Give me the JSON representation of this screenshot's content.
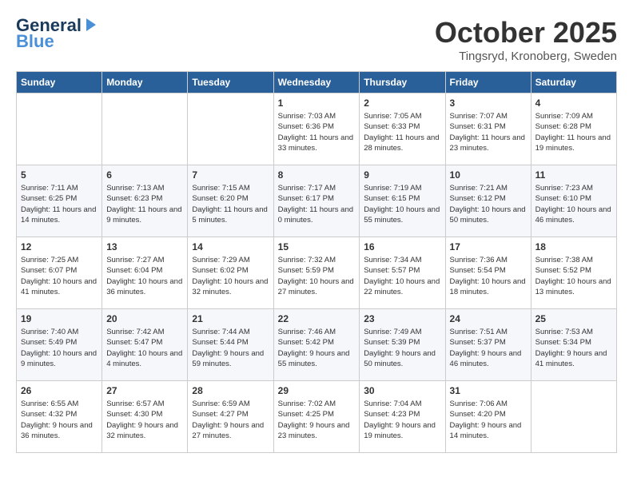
{
  "header": {
    "logo_line1": "General",
    "logo_line2": "Blue",
    "month": "October 2025",
    "location": "Tingsryd, Kronoberg, Sweden"
  },
  "days_of_week": [
    "Sunday",
    "Monday",
    "Tuesday",
    "Wednesday",
    "Thursday",
    "Friday",
    "Saturday"
  ],
  "weeks": [
    [
      {
        "num": "",
        "sunrise": "",
        "sunset": "",
        "daylight": ""
      },
      {
        "num": "",
        "sunrise": "",
        "sunset": "",
        "daylight": ""
      },
      {
        "num": "",
        "sunrise": "",
        "sunset": "",
        "daylight": ""
      },
      {
        "num": "1",
        "sunrise": "Sunrise: 7:03 AM",
        "sunset": "Sunset: 6:36 PM",
        "daylight": "Daylight: 11 hours and 33 minutes."
      },
      {
        "num": "2",
        "sunrise": "Sunrise: 7:05 AM",
        "sunset": "Sunset: 6:33 PM",
        "daylight": "Daylight: 11 hours and 28 minutes."
      },
      {
        "num": "3",
        "sunrise": "Sunrise: 7:07 AM",
        "sunset": "Sunset: 6:31 PM",
        "daylight": "Daylight: 11 hours and 23 minutes."
      },
      {
        "num": "4",
        "sunrise": "Sunrise: 7:09 AM",
        "sunset": "Sunset: 6:28 PM",
        "daylight": "Daylight: 11 hours and 19 minutes."
      }
    ],
    [
      {
        "num": "5",
        "sunrise": "Sunrise: 7:11 AM",
        "sunset": "Sunset: 6:25 PM",
        "daylight": "Daylight: 11 hours and 14 minutes."
      },
      {
        "num": "6",
        "sunrise": "Sunrise: 7:13 AM",
        "sunset": "Sunset: 6:23 PM",
        "daylight": "Daylight: 11 hours and 9 minutes."
      },
      {
        "num": "7",
        "sunrise": "Sunrise: 7:15 AM",
        "sunset": "Sunset: 6:20 PM",
        "daylight": "Daylight: 11 hours and 5 minutes."
      },
      {
        "num": "8",
        "sunrise": "Sunrise: 7:17 AM",
        "sunset": "Sunset: 6:17 PM",
        "daylight": "Daylight: 11 hours and 0 minutes."
      },
      {
        "num": "9",
        "sunrise": "Sunrise: 7:19 AM",
        "sunset": "Sunset: 6:15 PM",
        "daylight": "Daylight: 10 hours and 55 minutes."
      },
      {
        "num": "10",
        "sunrise": "Sunrise: 7:21 AM",
        "sunset": "Sunset: 6:12 PM",
        "daylight": "Daylight: 10 hours and 50 minutes."
      },
      {
        "num": "11",
        "sunrise": "Sunrise: 7:23 AM",
        "sunset": "Sunset: 6:10 PM",
        "daylight": "Daylight: 10 hours and 46 minutes."
      }
    ],
    [
      {
        "num": "12",
        "sunrise": "Sunrise: 7:25 AM",
        "sunset": "Sunset: 6:07 PM",
        "daylight": "Daylight: 10 hours and 41 minutes."
      },
      {
        "num": "13",
        "sunrise": "Sunrise: 7:27 AM",
        "sunset": "Sunset: 6:04 PM",
        "daylight": "Daylight: 10 hours and 36 minutes."
      },
      {
        "num": "14",
        "sunrise": "Sunrise: 7:29 AM",
        "sunset": "Sunset: 6:02 PM",
        "daylight": "Daylight: 10 hours and 32 minutes."
      },
      {
        "num": "15",
        "sunrise": "Sunrise: 7:32 AM",
        "sunset": "Sunset: 5:59 PM",
        "daylight": "Daylight: 10 hours and 27 minutes."
      },
      {
        "num": "16",
        "sunrise": "Sunrise: 7:34 AM",
        "sunset": "Sunset: 5:57 PM",
        "daylight": "Daylight: 10 hours and 22 minutes."
      },
      {
        "num": "17",
        "sunrise": "Sunrise: 7:36 AM",
        "sunset": "Sunset: 5:54 PM",
        "daylight": "Daylight: 10 hours and 18 minutes."
      },
      {
        "num": "18",
        "sunrise": "Sunrise: 7:38 AM",
        "sunset": "Sunset: 5:52 PM",
        "daylight": "Daylight: 10 hours and 13 minutes."
      }
    ],
    [
      {
        "num": "19",
        "sunrise": "Sunrise: 7:40 AM",
        "sunset": "Sunset: 5:49 PM",
        "daylight": "Daylight: 10 hours and 9 minutes."
      },
      {
        "num": "20",
        "sunrise": "Sunrise: 7:42 AM",
        "sunset": "Sunset: 5:47 PM",
        "daylight": "Daylight: 10 hours and 4 minutes."
      },
      {
        "num": "21",
        "sunrise": "Sunrise: 7:44 AM",
        "sunset": "Sunset: 5:44 PM",
        "daylight": "Daylight: 9 hours and 59 minutes."
      },
      {
        "num": "22",
        "sunrise": "Sunrise: 7:46 AM",
        "sunset": "Sunset: 5:42 PM",
        "daylight": "Daylight: 9 hours and 55 minutes."
      },
      {
        "num": "23",
        "sunrise": "Sunrise: 7:49 AM",
        "sunset": "Sunset: 5:39 PM",
        "daylight": "Daylight: 9 hours and 50 minutes."
      },
      {
        "num": "24",
        "sunrise": "Sunrise: 7:51 AM",
        "sunset": "Sunset: 5:37 PM",
        "daylight": "Daylight: 9 hours and 46 minutes."
      },
      {
        "num": "25",
        "sunrise": "Sunrise: 7:53 AM",
        "sunset": "Sunset: 5:34 PM",
        "daylight": "Daylight: 9 hours and 41 minutes."
      }
    ],
    [
      {
        "num": "26",
        "sunrise": "Sunrise: 6:55 AM",
        "sunset": "Sunset: 4:32 PM",
        "daylight": "Daylight: 9 hours and 36 minutes."
      },
      {
        "num": "27",
        "sunrise": "Sunrise: 6:57 AM",
        "sunset": "Sunset: 4:30 PM",
        "daylight": "Daylight: 9 hours and 32 minutes."
      },
      {
        "num": "28",
        "sunrise": "Sunrise: 6:59 AM",
        "sunset": "Sunset: 4:27 PM",
        "daylight": "Daylight: 9 hours and 27 minutes."
      },
      {
        "num": "29",
        "sunrise": "Sunrise: 7:02 AM",
        "sunset": "Sunset: 4:25 PM",
        "daylight": "Daylight: 9 hours and 23 minutes."
      },
      {
        "num": "30",
        "sunrise": "Sunrise: 7:04 AM",
        "sunset": "Sunset: 4:23 PM",
        "daylight": "Daylight: 9 hours and 19 minutes."
      },
      {
        "num": "31",
        "sunrise": "Sunrise: 7:06 AM",
        "sunset": "Sunset: 4:20 PM",
        "daylight": "Daylight: 9 hours and 14 minutes."
      },
      {
        "num": "",
        "sunrise": "",
        "sunset": "",
        "daylight": ""
      }
    ]
  ]
}
